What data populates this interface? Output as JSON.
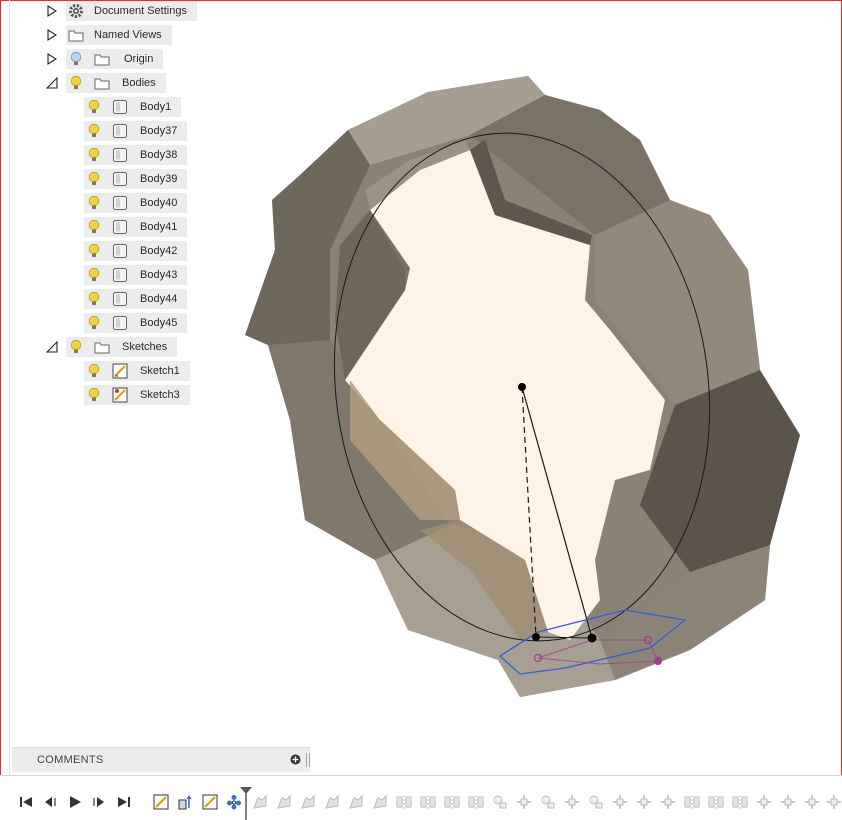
{
  "browser": {
    "document_settings": "Document Settings",
    "named_views": "Named Views",
    "origin": "Origin",
    "bodies": {
      "label": "Bodies",
      "items": [
        "Body1",
        "Body37",
        "Body38",
        "Body39",
        "Body40",
        "Body41",
        "Body42",
        "Body43",
        "Body44",
        "Body45"
      ]
    },
    "sketches": {
      "label": "Sketches",
      "items": [
        "Sketch1",
        "Sketch3"
      ]
    }
  },
  "comments": {
    "label": "COMMENTS"
  },
  "timeline": {
    "controls": [
      "go-to-start",
      "step-back",
      "play",
      "step-forward",
      "go-to-end"
    ],
    "features": [
      "sketch",
      "extrude",
      "sketch",
      "pattern",
      "body-pattern",
      "body-pattern",
      "body-pattern",
      "body-pattern",
      "body-pattern",
      "body-pattern",
      "mirror",
      "mirror",
      "mirror",
      "mirror",
      "combine",
      "move",
      "combine",
      "move",
      "combine",
      "move",
      "mirror",
      "mirror",
      "mirror",
      "move",
      "move",
      "move",
      "move"
    ]
  },
  "colors": {
    "accent_bulb": "#f2d23a",
    "body_fill": "#8b8375",
    "interior": "#fdf4e8",
    "selection_blue": "#2f5fe0",
    "constraint_purple": "#a03c8c"
  }
}
